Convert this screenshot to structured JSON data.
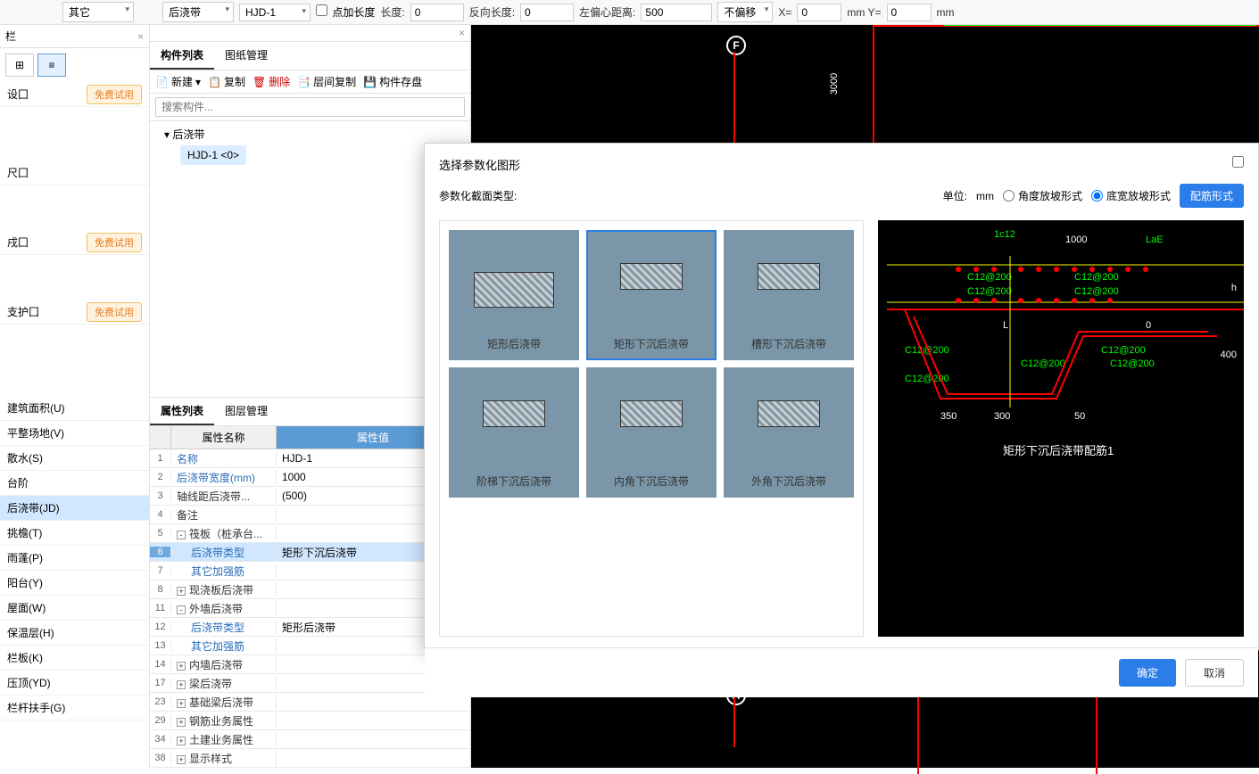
{
  "toolbar": {
    "dropdown1": "其它",
    "dropdown2": "后浇带",
    "dropdown3": "HJD-1",
    "pointLength": "点加长度",
    "lengthLabel": "长度:",
    "lengthVal": "0",
    "reverseLength": "反向长度:",
    "reverseLengthVal": "0",
    "leftOffset": "左偏心距离:",
    "leftOffsetVal": "500",
    "noOffset": "不偏移",
    "xLabel": "X=",
    "xVal": "0",
    "mmY": "mm Y=",
    "yVal": "0",
    "mm": "mm"
  },
  "leftPanel": {
    "tab": "栏",
    "items": [
      "设囗",
      "尺囗",
      "戌囗",
      "支护囗"
    ],
    "tryFree": "免费试用",
    "navItems": [
      "建筑面积(U)",
      "平整场地(V)",
      "散水(S)",
      "台阶",
      "后浇带(JD)",
      "挑檐(T)",
      "雨蓬(P)",
      "阳台(Y)",
      "屋面(W)",
      "保温层(H)",
      "栏板(K)",
      "压顶(YD)",
      "栏杆扶手(G)"
    ]
  },
  "componentPanel": {
    "tabs": [
      "构件列表",
      "图纸管理"
    ],
    "toolbar": [
      "新建",
      "复制",
      "删除",
      "层间复制",
      "构件存盘"
    ],
    "searchPlaceholder": "搜索构件...",
    "treeParent": "后浇带",
    "treeChild": "HJD-1 <0>"
  },
  "propPanel": {
    "tabs": [
      "属性列表",
      "图层管理"
    ],
    "headers": [
      "属性名称",
      "属性值"
    ],
    "rows": [
      {
        "num": "1",
        "name": "名称",
        "val": "HJD-1",
        "link": true
      },
      {
        "num": "2",
        "name": "后浇带宽度(mm)",
        "val": "1000",
        "link": true
      },
      {
        "num": "3",
        "name": "轴线距后浇带...",
        "val": "(500)"
      },
      {
        "num": "4",
        "name": "备注",
        "val": ""
      },
      {
        "num": "5",
        "name": "筏板（桩承台...",
        "val": "",
        "expand": "-"
      },
      {
        "num": "6",
        "name": "后浇带类型",
        "val": "矩形下沉后浇带",
        "link": true,
        "indent": true,
        "active": true,
        "more": true
      },
      {
        "num": "7",
        "name": "其它加强筋",
        "val": "",
        "link": true,
        "indent": true
      },
      {
        "num": "8",
        "name": "现浇板后浇带",
        "val": "",
        "expand": "+"
      },
      {
        "num": "11",
        "name": "外墙后浇带",
        "val": "",
        "expand": "-"
      },
      {
        "num": "12",
        "name": "后浇带类型",
        "val": "矩形后浇带",
        "link": true,
        "indent": true
      },
      {
        "num": "13",
        "name": "其它加强筋",
        "val": "",
        "link": true,
        "indent": true
      },
      {
        "num": "14",
        "name": "内墙后浇带",
        "val": "",
        "expand": "+"
      },
      {
        "num": "17",
        "name": "梁后浇带",
        "val": "",
        "expand": "+"
      },
      {
        "num": "23",
        "name": "基础梁后浇带",
        "val": "",
        "expand": "+"
      },
      {
        "num": "29",
        "name": "钢筋业务属性",
        "val": "",
        "expand": "+"
      },
      {
        "num": "34",
        "name": "土建业务属性",
        "val": "",
        "expand": "+"
      },
      {
        "num": "38",
        "name": "显示样式",
        "val": "",
        "expand": "+"
      }
    ]
  },
  "canvas": {
    "markF": "F",
    "markA": "A",
    "dim3000": "3000"
  },
  "modal": {
    "title": "选择参数化图形",
    "subtitle": "参数化截面类型:",
    "unitLabel": "单位:",
    "unit": "mm",
    "radio1": "角度放坡形式",
    "radio2": "底宽放坡形式",
    "configBtn": "配筋形式",
    "shapes": [
      "矩形后浇带",
      "矩形下沉后浇带",
      "槽形下沉后浇带",
      "阶梯下沉后浇带",
      "内角下沉后浇带",
      "外角下沉后浇带"
    ],
    "diagramTitle": "矩形下沉后浇带配筋1",
    "labels": {
      "c12_1": "1c12",
      "w1000": "1000",
      "lae": "LaE",
      "c12200": "C12@200",
      "L": "L",
      "h": "h",
      "zero": "0",
      "w400": "400",
      "w350": "350",
      "w300": "300",
      "w50": "50"
    },
    "okBtn": "确定",
    "cancelBtn": "取消"
  }
}
